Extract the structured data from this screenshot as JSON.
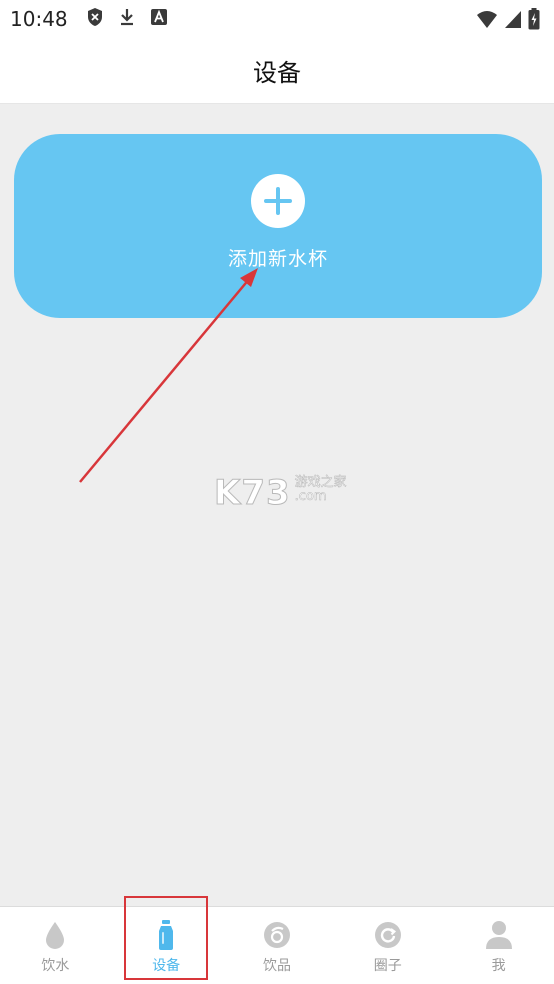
{
  "status_bar": {
    "time": "10:48",
    "left_icons": [
      "shield-icon",
      "download-icon",
      "a-icon"
    ],
    "right_icons": [
      "wifi-icon",
      "signal-icon",
      "battery-icon"
    ]
  },
  "header": {
    "title": "设备"
  },
  "add_card": {
    "label": "添加新水杯",
    "icon": "plus-icon",
    "color": "#66c6f2"
  },
  "watermark": {
    "brand": "K73",
    "cn": "游戏之家",
    "domain": ".com"
  },
  "tabs": [
    {
      "label": "饮水",
      "icon": "drop-icon",
      "active": false
    },
    {
      "label": "设备",
      "icon": "bottle-icon",
      "active": true
    },
    {
      "label": "饮品",
      "icon": "drink-icon",
      "active": false
    },
    {
      "label": "圈子",
      "icon": "circle-refresh-icon",
      "active": false
    },
    {
      "label": "我",
      "icon": "person-icon",
      "active": false
    }
  ],
  "colors": {
    "accent": "#4fb8ec",
    "tab_inactive": "#9a9a9a",
    "annotation_red": "#d8363a"
  }
}
